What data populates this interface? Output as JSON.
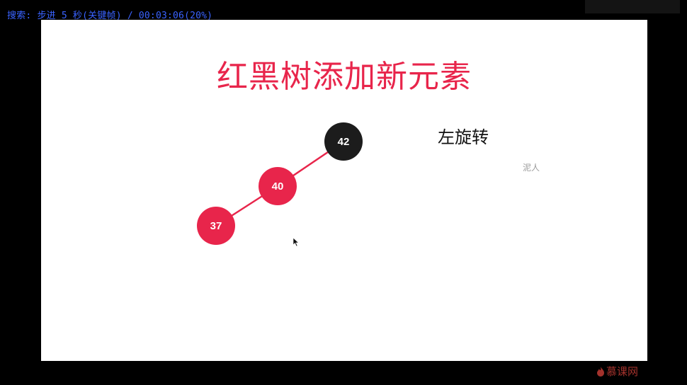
{
  "overlay": {
    "search_text": "搜索: 步进 5 秒(关键帧) / 00:03:06(20%)"
  },
  "slide": {
    "title": "红黑树添加新元素",
    "operation_label": "左旋转",
    "watermark": "泥人",
    "nodes": [
      {
        "value": "42",
        "color": "black"
      },
      {
        "value": "40",
        "color": "red"
      },
      {
        "value": "37",
        "color": "red"
      }
    ]
  },
  "branding": {
    "logo_text": "慕课网"
  },
  "colors": {
    "red_node": "#e8254b",
    "black_node": "#1c1c1c",
    "overlay_text": "#3a63ff"
  }
}
